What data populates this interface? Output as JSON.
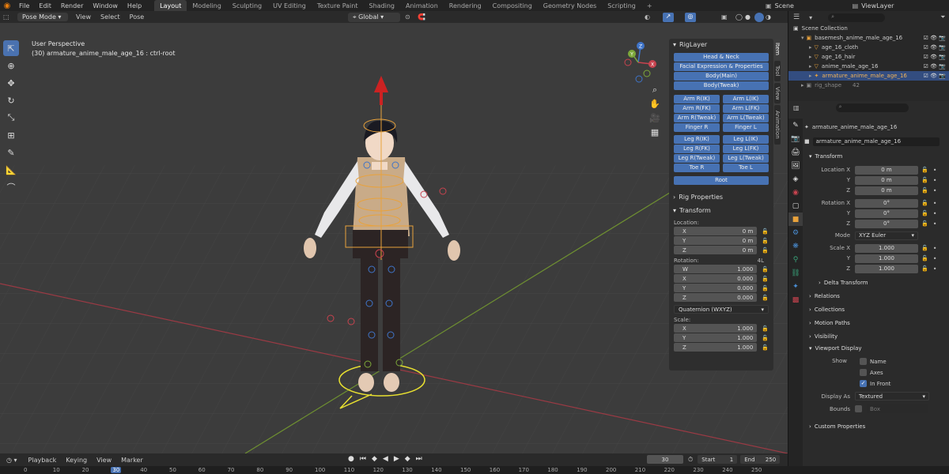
{
  "menubar": {
    "items": [
      "File",
      "Edit",
      "Render",
      "Window",
      "Help"
    ],
    "workspaces": [
      "Layout",
      "Modeling",
      "Sculpting",
      "UV Editing",
      "Texture Paint",
      "Shading",
      "Animation",
      "Rendering",
      "Compositing",
      "Geometry Nodes",
      "Scripting"
    ],
    "active_workspace": "Layout",
    "add_tab": "+",
    "scene": "Scene",
    "view_layer": "ViewLayer"
  },
  "viewport_header": {
    "mode": "Pose Mode",
    "menus": [
      "View",
      "Select",
      "Pose"
    ],
    "orientation": "Global",
    "pose_options": "Pose Options"
  },
  "viewport": {
    "view_name": "User Perspective",
    "active_info": "(30) armature_anime_male_age_16 : ctrl-root",
    "gizmo": {
      "z": "Z",
      "y": "Y",
      "x": "X"
    }
  },
  "npanel": {
    "tabs": [
      "Item",
      "Tool",
      "View",
      "Animation"
    ],
    "riglayer_title": "RigLayer",
    "rig_buttons_single": [
      "Head & Neck",
      "Facial Expression & Properties",
      "Body(Main)",
      "Body(Tweak)"
    ],
    "arm_buttons": [
      [
        "Arm R(IK)",
        "Arm L(IK)"
      ],
      [
        "Arm R(FK)",
        "Arm L(FK)"
      ],
      [
        "Arm R(Tweak)",
        "Arm L(Tweak)"
      ],
      [
        "Finger R",
        "Finger L"
      ]
    ],
    "leg_buttons": [
      [
        "Leg R(IK)",
        "Leg L(IK)"
      ],
      [
        "Leg R(FK)",
        "Leg L(FK)"
      ],
      [
        "Leg R(Tweak)",
        "Leg L(Tweak)"
      ],
      [
        "Toe R",
        "Toe L"
      ]
    ],
    "root_button": "Root",
    "rig_properties": "Rig Properties",
    "transform": "Transform",
    "location_label": "Location:",
    "location": [
      {
        "axis": "X",
        "value": "0 m"
      },
      {
        "axis": "Y",
        "value": "0 m"
      },
      {
        "axis": "Z",
        "value": "0 m"
      }
    ],
    "rotation_label": "Rotation:",
    "rotation_mode_short": "4L",
    "rotation": [
      {
        "axis": "W",
        "value": "1.000"
      },
      {
        "axis": "X",
        "value": "0.000"
      },
      {
        "axis": "Y",
        "value": "0.000"
      },
      {
        "axis": "Z",
        "value": "0.000"
      }
    ],
    "rotation_mode": "Quaternion (WXYZ)",
    "scale_label": "Scale:",
    "scale": [
      {
        "axis": "X",
        "value": "1.000"
      },
      {
        "axis": "Y",
        "value": "1.000"
      },
      {
        "axis": "Z",
        "value": "1.000"
      }
    ]
  },
  "outliner": {
    "search_placeholder": "",
    "scene_collection": "Scene Collection",
    "items": [
      {
        "name": "basemesh_anime_male_age_16",
        "indent": 1,
        "selected": false
      },
      {
        "name": "age_16_cloth",
        "indent": 2,
        "selected": false
      },
      {
        "name": "age_16_hair",
        "indent": 2,
        "selected": false
      },
      {
        "name": "anime_male_age_16",
        "indent": 2,
        "selected": false
      },
      {
        "name": "armature_anime_male_age_16",
        "indent": 2,
        "selected": true
      },
      {
        "name": "rig_shape",
        "indent": 1,
        "selected": false
      }
    ],
    "rig_shape_count": "42"
  },
  "properties": {
    "object_name": "armature_anime_male_age_16",
    "data_name": "armature_anime_male_age_16",
    "transform": "Transform",
    "location_label": "Location X",
    "location": [
      "0 m",
      "0 m",
      "0 m"
    ],
    "rotation_label": "Rotation X",
    "rotation": [
      "0°",
      "0°",
      "0°"
    ],
    "mode_label": "Mode",
    "mode": "XYZ Euler",
    "scale_label": "Scale X",
    "scale": [
      "1.000",
      "1.000",
      "1.000"
    ],
    "axis_y": "Y",
    "axis_z": "Z",
    "delta_transform": "Delta Transform",
    "sections": [
      "Relations",
      "Collections",
      "Motion Paths",
      "Visibility"
    ],
    "viewport_display": "Viewport Display",
    "show_label": "Show",
    "checkboxes": [
      {
        "label": "Name",
        "checked": false
      },
      {
        "label": "Axes",
        "checked": false
      },
      {
        "label": "In Front",
        "checked": true
      }
    ],
    "display_as_label": "Display As",
    "display_as": "Textured",
    "bounds_label": "Bounds",
    "bounds": "Box",
    "custom_properties": "Custom Properties"
  },
  "timeline": {
    "menus": [
      "Playback",
      "Keying",
      "View",
      "Marker"
    ],
    "current_frame": "30",
    "start_label": "Start",
    "start": "1",
    "end_label": "End",
    "end": "250",
    "ticks": [
      "0",
      "10",
      "20",
      "30",
      "40",
      "50",
      "60",
      "70",
      "80",
      "90",
      "100",
      "110",
      "120",
      "130",
      "140",
      "150",
      "160",
      "170",
      "180",
      "190",
      "200",
      "210",
      "220",
      "230",
      "240",
      "250"
    ]
  },
  "colors": {
    "accent": "#4772b3",
    "x_axis": "#c8434f",
    "y_axis": "#7da83a",
    "z_axis": "#3f74c8",
    "selection": "#e9a23b"
  }
}
